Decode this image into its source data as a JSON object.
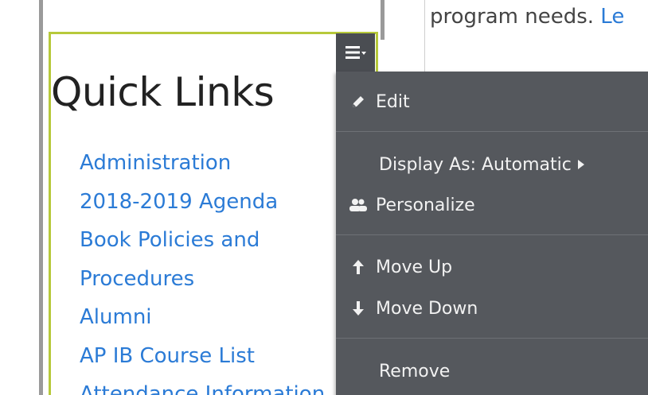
{
  "right_panel": {
    "text": "program needs. ",
    "link": "Le"
  },
  "quick_links": {
    "title": "Quick Links",
    "items": [
      "Administration",
      "2018-2019 Agenda",
      "Book Policies and",
      "Procedures",
      "Alumni",
      "AP IB Course List",
      "Attendance Information"
    ]
  },
  "menu": {
    "toggle_icon": "hamburger-dropdown-icon",
    "edit": "Edit",
    "display_as": "Display As: Automatic",
    "personalize": "Personalize",
    "move_up": "Move Up",
    "move_down": "Move Down",
    "remove": "Remove"
  },
  "colors": {
    "accent_border": "#b7c93a",
    "link": "#2b7bd6",
    "menu_bg": "#55585d"
  }
}
